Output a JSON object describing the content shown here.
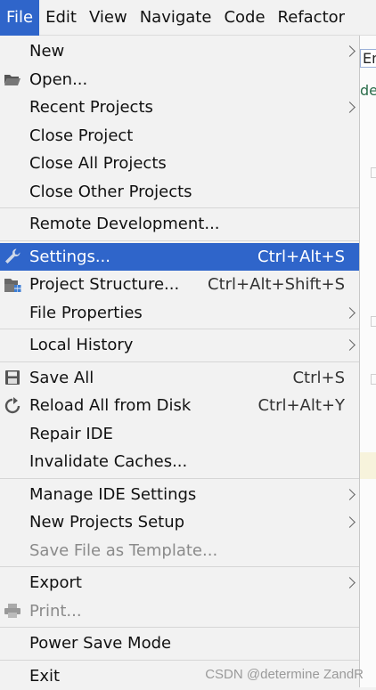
{
  "menubar": [
    {
      "label": "File",
      "active": true
    },
    {
      "label": "Edit"
    },
    {
      "label": "View"
    },
    {
      "label": "Navigate"
    },
    {
      "label": "Code"
    },
    {
      "label": "Refactor"
    }
  ],
  "background": {
    "frag1": "Em",
    "frag2": "de"
  },
  "menu": {
    "new": "New",
    "open": "Open...",
    "recent_projects": "Recent Projects",
    "close_project": "Close Project",
    "close_all_projects": "Close All Projects",
    "close_other_projects": "Close Other Projects",
    "remote_development": "Remote Development...",
    "settings": "Settings...",
    "settings_shortcut": "Ctrl+Alt+S",
    "project_structure": "Project Structure...",
    "project_structure_shortcut": "Ctrl+Alt+Shift+S",
    "file_properties": "File Properties",
    "local_history": "Local History",
    "save_all": "Save All",
    "save_all_shortcut": "Ctrl+S",
    "reload_all": "Reload All from Disk",
    "reload_all_shortcut": "Ctrl+Alt+Y",
    "repair_ide": "Repair IDE",
    "invalidate_caches": "Invalidate Caches...",
    "manage_ide_settings": "Manage IDE Settings",
    "new_projects_setup": "New Projects Setup",
    "save_file_as_template": "Save File as Template...",
    "export": "Export",
    "print": "Print...",
    "power_save_mode": "Power Save Mode",
    "exit": "Exit"
  },
  "watermark": "CSDN @determine ZandR",
  "colors": {
    "selection": "#2f65ca",
    "menu_bg": "#f2f2f2",
    "disabled": "#8a8a8a"
  }
}
